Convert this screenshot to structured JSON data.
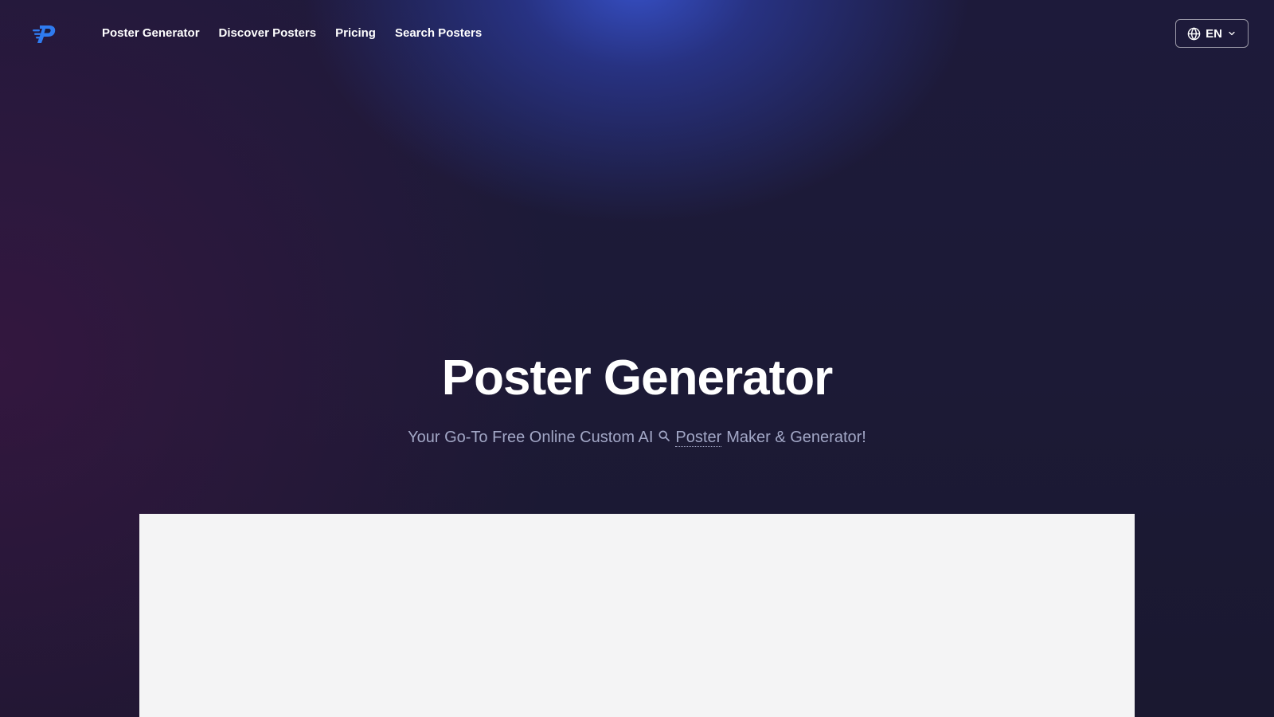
{
  "nav": {
    "logo_icon": "poster-logo-icon",
    "links": [
      {
        "label": "Poster Generator"
      },
      {
        "label": "Discover Posters"
      },
      {
        "label": "Pricing"
      },
      {
        "label": "Search Posters"
      }
    ],
    "language": {
      "icon": "globe-icon",
      "label": "EN",
      "dropdown_icon": "chevron-down-icon"
    }
  },
  "hero": {
    "title": "Poster Generator",
    "subtitle_before": "Your Go-To Free Online Custom AI",
    "subtitle_icon": "search-icon",
    "subtitle_keyword": "Poster",
    "subtitle_after": "Maker & Generator!"
  },
  "colors": {
    "accent": "#3a58dc",
    "logo_blue": "#2f7bf0",
    "panel_bg": "#f4f4f5",
    "subtitle": "#a2a7c6"
  }
}
